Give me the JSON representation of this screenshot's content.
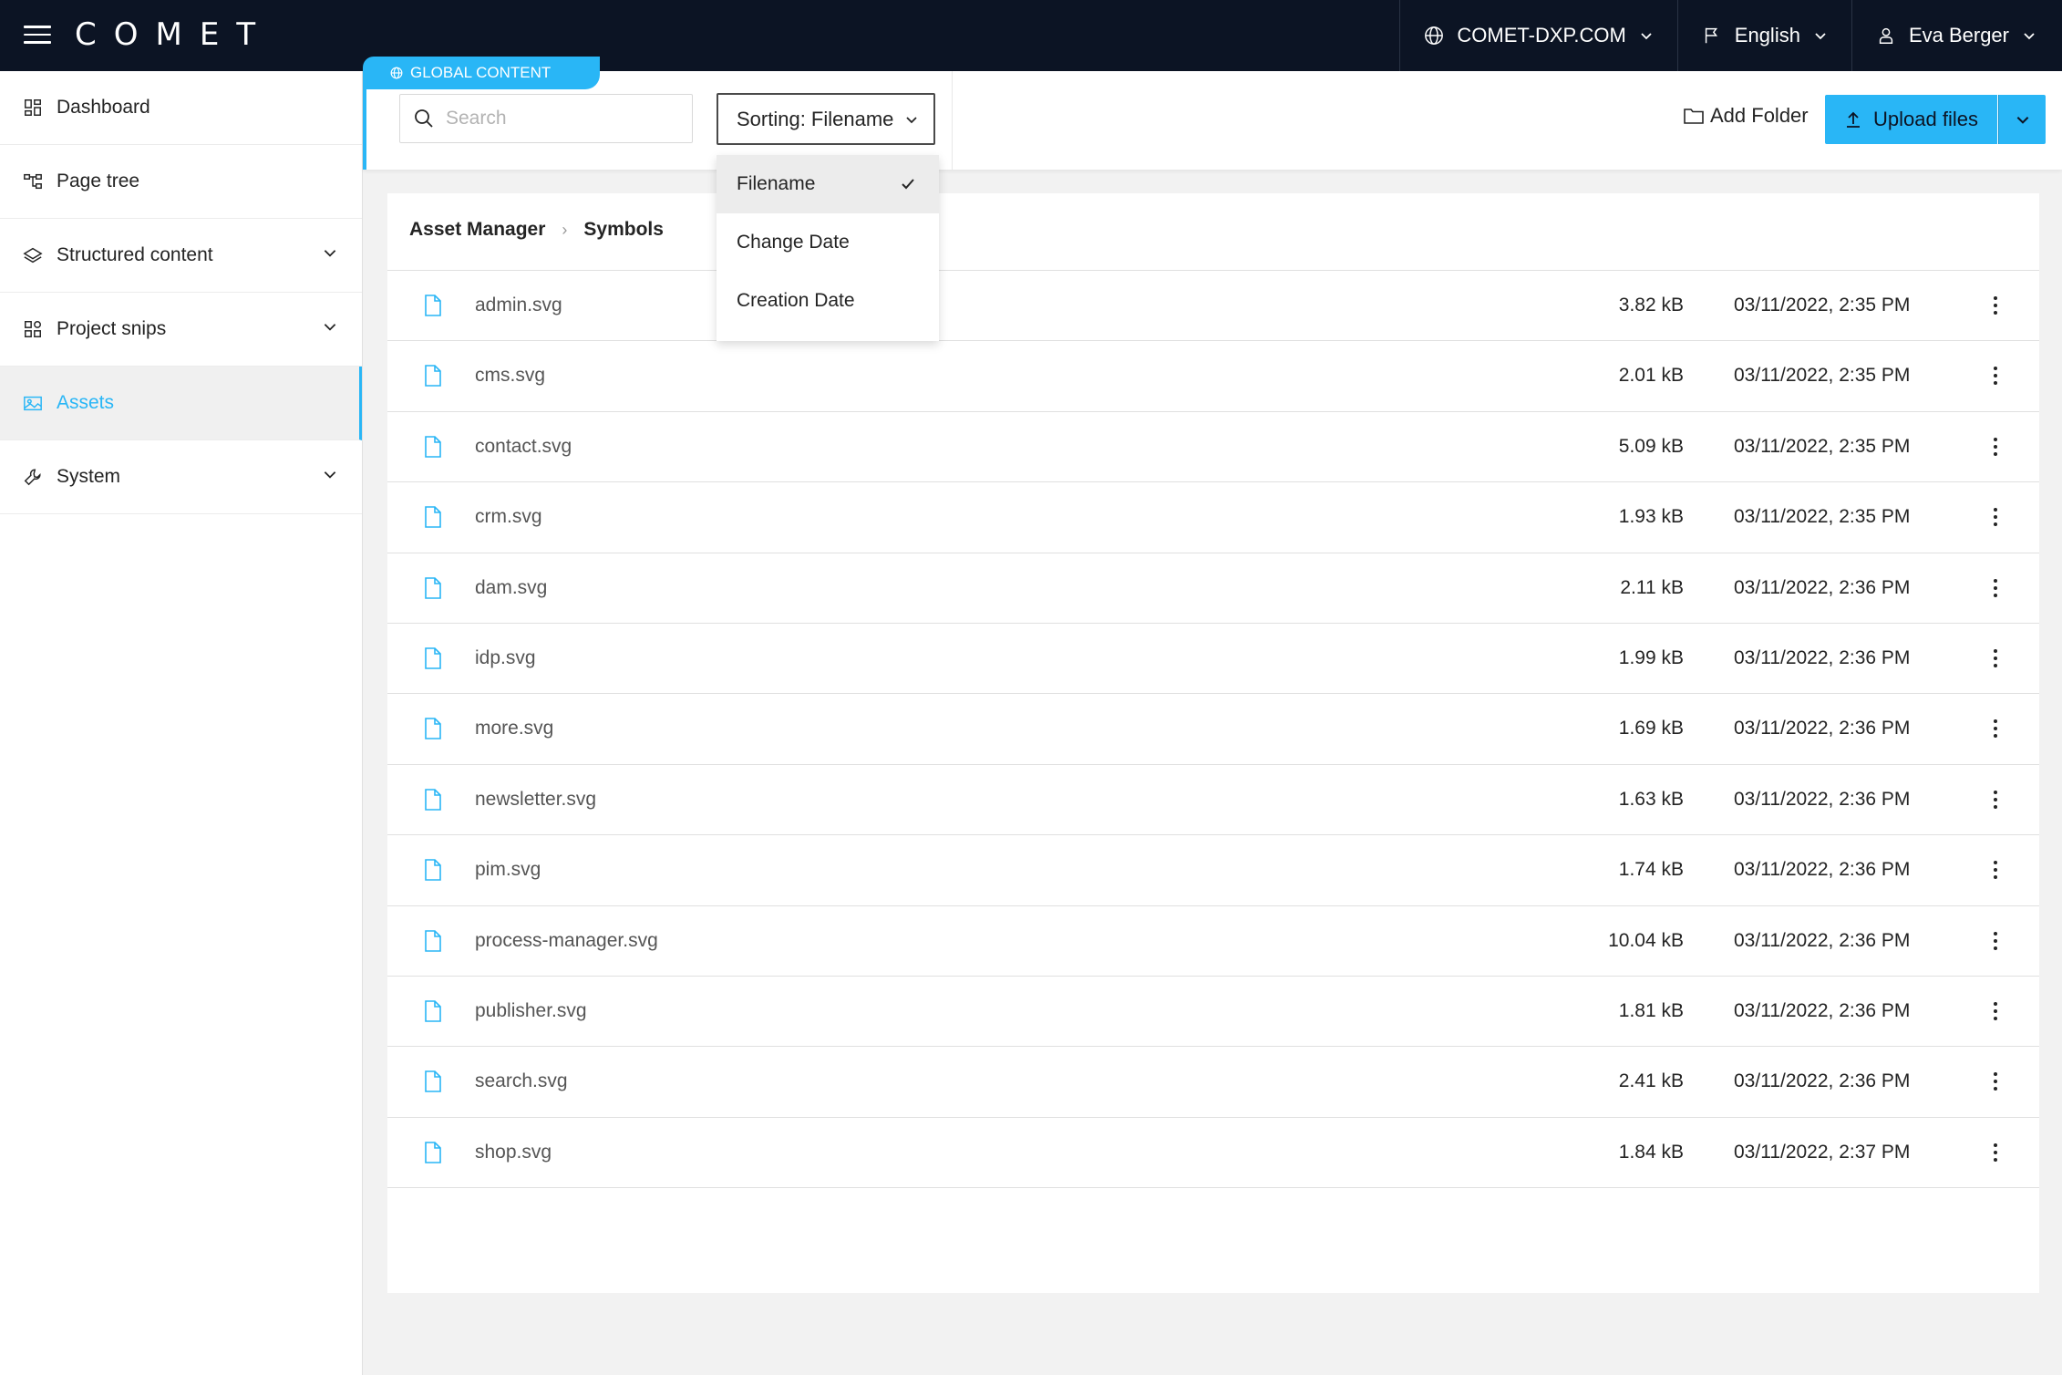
{
  "topbar": {
    "logo": "COMET",
    "domain": "COMET-DXP.COM",
    "language": "English",
    "user": "Eva Berger"
  },
  "sidebar": {
    "items": [
      {
        "label": "Dashboard",
        "icon": "dashboard-icon",
        "expandable": false
      },
      {
        "label": "Page tree",
        "icon": "page-tree-icon",
        "expandable": false
      },
      {
        "label": "Structured content",
        "icon": "layers-icon",
        "expandable": true
      },
      {
        "label": "Project snips",
        "icon": "snips-icon",
        "expandable": true
      },
      {
        "label": "Assets",
        "icon": "assets-icon",
        "expandable": false,
        "active": true
      },
      {
        "label": "System",
        "icon": "wrench-icon",
        "expandable": true
      }
    ]
  },
  "scope": {
    "label": "GLOBAL CONTENT"
  },
  "toolbar": {
    "search_placeholder": "Search",
    "sort_label": "Sorting: Filename",
    "add_folder": "Add Folder",
    "upload": "Upload files"
  },
  "sort_menu": {
    "options": [
      "Filename",
      "Change Date",
      "Creation Date"
    ],
    "selected": "Filename"
  },
  "breadcrumb": [
    "Asset Manager",
    "Symbols"
  ],
  "files": [
    {
      "name": "admin.svg",
      "size": "3.82 kB",
      "date": "03/11/2022, 2:35 PM"
    },
    {
      "name": "cms.svg",
      "size": "2.01 kB",
      "date": "03/11/2022, 2:35 PM"
    },
    {
      "name": "contact.svg",
      "size": "5.09 kB",
      "date": "03/11/2022, 2:35 PM"
    },
    {
      "name": "crm.svg",
      "size": "1.93 kB",
      "date": "03/11/2022, 2:35 PM"
    },
    {
      "name": "dam.svg",
      "size": "2.11 kB",
      "date": "03/11/2022, 2:36 PM"
    },
    {
      "name": "idp.svg",
      "size": "1.99 kB",
      "date": "03/11/2022, 2:36 PM"
    },
    {
      "name": "more.svg",
      "size": "1.69 kB",
      "date": "03/11/2022, 2:36 PM"
    },
    {
      "name": "newsletter.svg",
      "size": "1.63 kB",
      "date": "03/11/2022, 2:36 PM"
    },
    {
      "name": "pim.svg",
      "size": "1.74 kB",
      "date": "03/11/2022, 2:36 PM"
    },
    {
      "name": "process-manager.svg",
      "size": "10.04 kB",
      "date": "03/11/2022, 2:36 PM"
    },
    {
      "name": "publisher.svg",
      "size": "1.81 kB",
      "date": "03/11/2022, 2:36 PM"
    },
    {
      "name": "search.svg",
      "size": "2.41 kB",
      "date": "03/11/2022, 2:36 PM"
    },
    {
      "name": "shop.svg",
      "size": "1.84 kB",
      "date": "03/11/2022, 2:37 PM"
    }
  ],
  "colors": {
    "topbar_bg": "#0c1424",
    "accent": "#29b6f6"
  }
}
